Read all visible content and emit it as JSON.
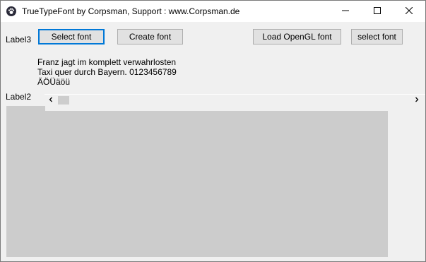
{
  "window": {
    "title": "TrueTypeFont by Corpsman, Support : www.Corpsman.de",
    "icon": "paw-app-icon",
    "controls": {
      "minimize_icon": "minimize-icon",
      "maximize_icon": "maximize-icon",
      "close_icon": "close-icon"
    }
  },
  "labels": {
    "label3": "Label3",
    "label2": "Label2"
  },
  "buttons": {
    "select_font": "Select font",
    "create_font": "Create font",
    "load_opengl_font": "Load OpenGL font",
    "select_font_2": "select font"
  },
  "sample_text": {
    "line1": "Franz jagt im komplett verwahrlosten",
    "line2": "Taxi quer durch Bayern. 0123456789",
    "line3": "ÄÖÜäöü"
  },
  "scrollbar": {
    "left_arrow_icon": "chevron-left-icon",
    "right_arrow_icon": "chevron-right-icon"
  },
  "colors": {
    "accent": "#0078d7",
    "canvas": "#cccccc",
    "background": "#f0f0f0"
  }
}
